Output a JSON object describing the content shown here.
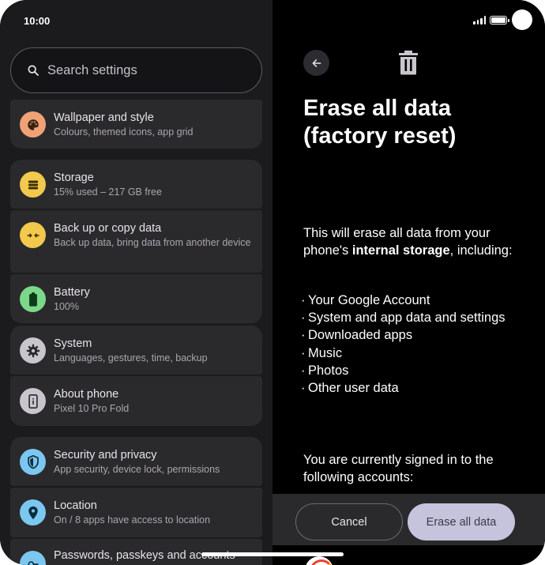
{
  "status_bar": {
    "time": "10:00"
  },
  "search": {
    "placeholder": "Search settings"
  },
  "settings_items": [
    {
      "title": "Wallpaper and style",
      "subtitle": "Colours, themed icons, app grid",
      "icon": "palette-icon",
      "color": "#f0a277"
    },
    {
      "title": "Storage",
      "subtitle": "15% used – 217 GB free",
      "icon": "storage-icon",
      "color": "#f2c94c"
    },
    {
      "title": "Back up or copy data",
      "subtitle": "Back up data, bring data from another device",
      "icon": "backup-transfer-icon",
      "color": "#f2c94c"
    },
    {
      "title": "Battery",
      "subtitle": "100%",
      "icon": "battery-icon",
      "color": "#7bd88a"
    },
    {
      "title": "System",
      "subtitle": "Languages, gestures, time, backup",
      "icon": "gear-icon",
      "color": "#c8c6cc"
    },
    {
      "title": "About phone",
      "subtitle": "Pixel 10 Pro Fold",
      "icon": "phone-info-icon",
      "color": "#c8c6cc"
    },
    {
      "title": "Security and privacy",
      "subtitle": "App security, device lock, permissions",
      "icon": "shield-icon",
      "color": "#7cc7f0"
    },
    {
      "title": "Location",
      "subtitle": "On / 8 apps have access to location",
      "icon": "location-pin-icon",
      "color": "#7cc7f0"
    },
    {
      "title": "Passwords, passkeys and accounts",
      "subtitle": "",
      "icon": "key-icon",
      "color": "#7cc7f0"
    }
  ],
  "detail": {
    "title": "Erase all data (factory reset)",
    "intro_before": "This will erase all data from your phone's ",
    "intro_bold": "internal storage",
    "intro_after": ", including:",
    "bullets": [
      "Your Google Account",
      "System and app data and settings",
      "Downloaded apps",
      "Music",
      "Photos",
      "Other user data"
    ],
    "signed_in_text": "You are currently signed in to the following accounts:"
  },
  "actions": {
    "cancel_label": "Cancel",
    "erase_label": "Erase all data"
  },
  "colors": {
    "background": "#1b1b1d",
    "card": "#2a2a2d",
    "detail_background": "#000000",
    "primary_button": "#c6c4dc"
  }
}
